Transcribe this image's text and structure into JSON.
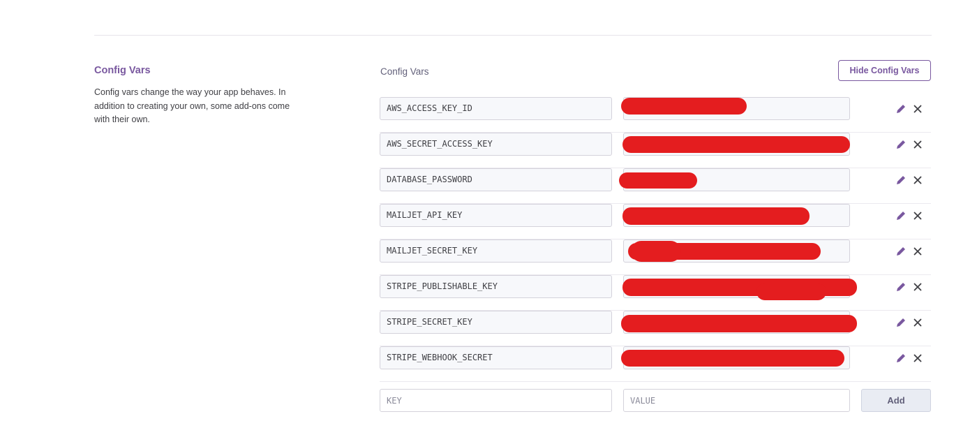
{
  "section": {
    "title": "Config Vars",
    "description": "Config vars change the way your app behaves. In addition to creating your own, some add-ons come with their own."
  },
  "panel": {
    "label": "Config Vars",
    "hide_button_label": "Hide Config Vars"
  },
  "config_vars": [
    {
      "key": "AWS_ACCESS_KEY_ID",
      "value": ""
    },
    {
      "key": "AWS_SECRET_ACCESS_KEY",
      "value": ""
    },
    {
      "key": "DATABASE_PASSWORD",
      "value": ""
    },
    {
      "key": "MAILJET_API_KEY",
      "value": ""
    },
    {
      "key": "MAILJET_SECRET_KEY",
      "value": ""
    },
    {
      "key": "STRIPE_PUBLISHABLE_KEY",
      "value": ""
    },
    {
      "key": "STRIPE_SECRET_KEY",
      "value": ""
    },
    {
      "key": "STRIPE_WEBHOOK_SECRET",
      "value": ""
    }
  ],
  "add_row": {
    "key_placeholder": "KEY",
    "value_placeholder": "VALUE",
    "add_button_label": "Add"
  },
  "icons": {
    "edit": "pencil-icon",
    "delete": "close-icon"
  },
  "colors": {
    "accent": "#79589f",
    "redaction": "#e41d1f"
  }
}
